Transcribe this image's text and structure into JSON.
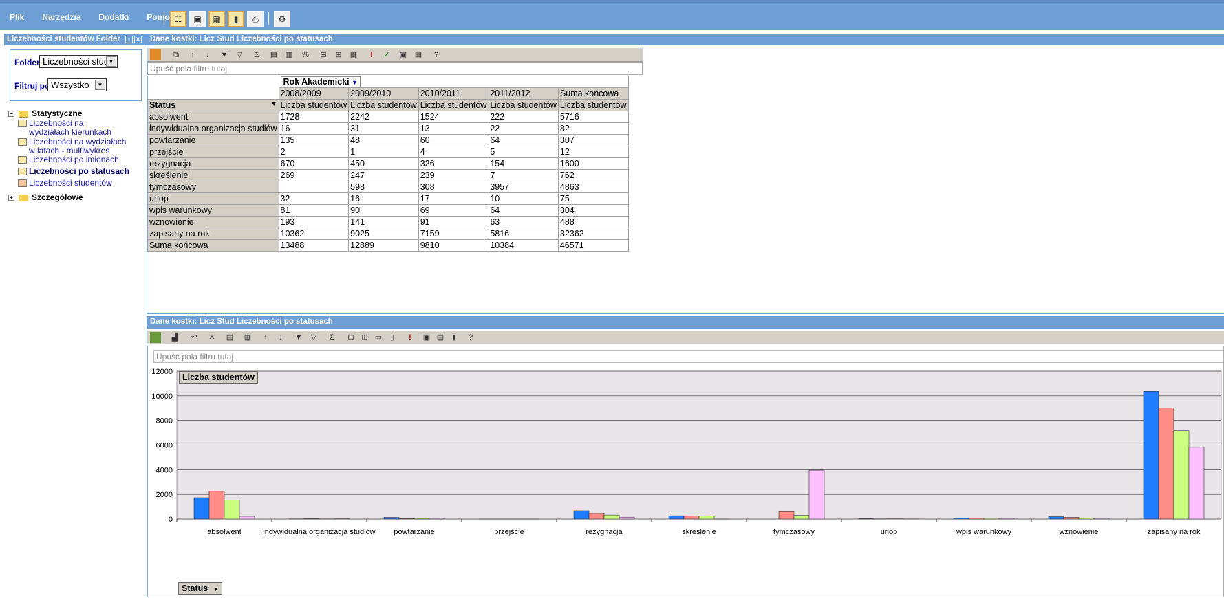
{
  "menu": [
    "Plik",
    "Narzędzia",
    "Dodatki",
    "Pomoc"
  ],
  "left_panel": {
    "title": "Liczebności studentów Folder",
    "folder_label": "Folder:",
    "folder_value": "Liczebności stude",
    "filter_label": "Filtruj po:",
    "filter_value": "Wszystko",
    "tree": {
      "statystyczne": "Statystyczne",
      "items": [
        "Liczebności na wydziałach kierunkach",
        "Liczebności na wydziałach w latach - multiwykres",
        "Liczebności po imionach",
        "Liczebności po statusach",
        "Liczebności studentów"
      ],
      "szczegolowe": "Szczegółowe"
    }
  },
  "pivot": {
    "title": "Dane kostki: Licz Stud Liczebności po statusach",
    "drop_placeholder": "Upuść pola filtru tutaj",
    "column_field": "Rok Akademicki",
    "row_field": "Status",
    "years": [
      "2008/2009",
      "2009/2010",
      "2010/2011",
      "2011/2012",
      "Suma końcowa"
    ],
    "measure": "Liczba studentów",
    "rows": [
      {
        "label": "absolwent",
        "v": [
          "1728",
          "2242",
          "1524",
          "222",
          "5716"
        ]
      },
      {
        "label": "indywidualna organizacja studiów",
        "v": [
          "16",
          "31",
          "13",
          "22",
          "82"
        ]
      },
      {
        "label": "powtarzanie",
        "v": [
          "135",
          "48",
          "60",
          "64",
          "307"
        ]
      },
      {
        "label": "przejście",
        "v": [
          "2",
          "1",
          "4",
          "5",
          "12"
        ]
      },
      {
        "label": "rezygnacja",
        "v": [
          "670",
          "450",
          "326",
          "154",
          "1600"
        ]
      },
      {
        "label": "skreślenie",
        "v": [
          "269",
          "247",
          "239",
          "7",
          "762"
        ]
      },
      {
        "label": "tymczasowy",
        "v": [
          "",
          "598",
          "308",
          "3957",
          "4863"
        ]
      },
      {
        "label": "urlop",
        "v": [
          "32",
          "16",
          "17",
          "10",
          "75"
        ]
      },
      {
        "label": "wpis warunkowy",
        "v": [
          "81",
          "90",
          "69",
          "64",
          "304"
        ]
      },
      {
        "label": "wznowienie",
        "v": [
          "193",
          "141",
          "91",
          "63",
          "488"
        ]
      },
      {
        "label": "zapisany na rok",
        "v": [
          "10362",
          "9025",
          "7159",
          "5816",
          "32362"
        ]
      },
      {
        "label": "Suma końcowa",
        "v": [
          "13488",
          "12889",
          "9810",
          "10384",
          "46571"
        ]
      }
    ]
  },
  "chart_panel": {
    "title": "Dane kostki: Licz Stud Liczebności po statusach",
    "drop_placeholder": "Upuść pola filtru tutaj",
    "measure_button": "Liczba studentów",
    "category_button": "Status"
  },
  "colors": {
    "s2008": "#1e7dff",
    "s2009": "#ff8c86",
    "s2010": "#ccff80",
    "s2011": "#ffc0ff",
    "header_blue": "#6d9fd4"
  },
  "chart_data": {
    "type": "bar",
    "categories": [
      "absolwent",
      "indywidualna organizacja studiów",
      "powtarzanie",
      "przejście",
      "rezygnacja",
      "skreślenie",
      "tymczasowy",
      "urlop",
      "wpis warunkowy",
      "wznowienie",
      "zapisany na rok"
    ],
    "series": [
      {
        "name": "2008/2009",
        "values": [
          1728,
          16,
          135,
          2,
          670,
          269,
          0,
          32,
          81,
          193,
          10362
        ]
      },
      {
        "name": "2009/2010",
        "values": [
          2242,
          31,
          48,
          1,
          450,
          247,
          598,
          16,
          90,
          141,
          9025
        ]
      },
      {
        "name": "2010/2011",
        "values": [
          1524,
          13,
          60,
          4,
          326,
          239,
          308,
          17,
          69,
          91,
          7159
        ]
      },
      {
        "name": "2011/2012",
        "values": [
          222,
          22,
          64,
          5,
          154,
          7,
          3957,
          10,
          64,
          63,
          5816
        ]
      }
    ],
    "yticks": [
      0,
      2000,
      4000,
      6000,
      8000,
      10000,
      12000
    ],
    "ylim": [
      0,
      12000
    ],
    "grid": true
  }
}
